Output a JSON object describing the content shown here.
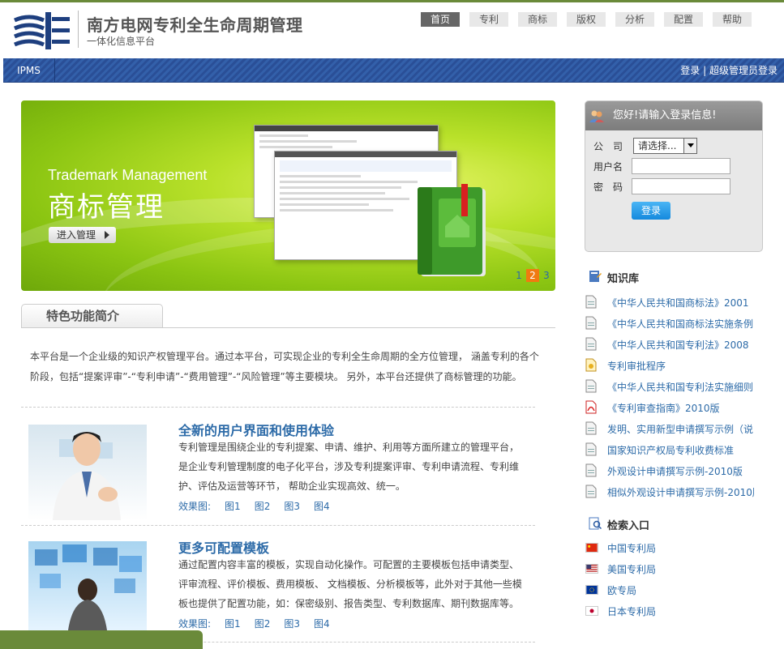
{
  "header": {
    "title": "南方电网专利全生命周期管理",
    "subtitle": "一体化信息平台",
    "nav": [
      "首页",
      "专利",
      "商标",
      "版权",
      "分析",
      "配置",
      "帮助"
    ]
  },
  "bar": {
    "app": "IPMS",
    "login": "登录",
    "separator": "|",
    "admin_login": "超级管理员登录"
  },
  "banner": {
    "en_title": "Trademark Management",
    "cn_title": "商标管理",
    "enter_button": "进入管理",
    "pages": [
      "1",
      "2",
      "3"
    ],
    "current_page": "2"
  },
  "features": {
    "tab": "特色功能简介",
    "intro": "本平台是一个企业级的知识产权管理平台。通过本平台，可实现企业的专利全生命周期的全方位管理， 涵盖专利的各个阶段，包括“提案评审”-“专利申请”-“费用管理”-“风险管理”等主要模块。 另外，本平台还提供了商标管理的功能。",
    "items": [
      {
        "title": "全新的用户界面和使用体验",
        "desc": "专利管理是围绕企业的专利提案、申请、维护、利用等方面所建立的管理平台，是企业专利管理制度的电子化平台，涉及专利提案评审、专利申请流程、专利维护、评估及运营等环节， 帮助企业实现高效、统一。",
        "effects_label": "效果图:",
        "effects": [
          "图1",
          "图2",
          "图3",
          "图4"
        ]
      },
      {
        "title": "更多可配置模板",
        "desc": "通过配置内容丰富的模板，实现自动化操作。可配置的主要模板包括申请类型、评审流程、评价模板、费用模板、 文档模板、分析模板等，此外对于其他一些模板也提供了配置功能，如：保密级别、报告类型、专利数据库、期刊数据库等。",
        "effects_label": "效果图:",
        "effects": [
          "图1",
          "图2",
          "图3",
          "图4"
        ]
      }
    ]
  },
  "login": {
    "greeting": "您好!请输入登录信息!",
    "company_label": "公　司",
    "company_select": "请选择...",
    "username_label": "用户名",
    "password_label": "密　码",
    "submit": "登录"
  },
  "knowledge": {
    "title": "知识库",
    "items": [
      "《中华人民共和国商标法》2001",
      "《中华人民共和国商标法实施条例",
      "《中华人民共和国专利法》2008",
      "专利审批程序",
      "《中华人民共和国专利法实施细则",
      "《专利审查指南》2010版",
      "发明、实用新型申请撰写示例（说",
      "国家知识产权局专利收费标准",
      "外观设计申请撰写示例-2010版",
      "相似外观设计申请撰写示例-2010版"
    ]
  },
  "search": {
    "title": "检索入口",
    "items": [
      "中国专利局",
      "美国专利局",
      "欧专局",
      "日本专利局"
    ]
  },
  "colors": {
    "link": "#2d6ba8",
    "bar_blue": "#2a4f97",
    "accent_orange": "#f07a10",
    "banner_green": "#8bc512"
  }
}
